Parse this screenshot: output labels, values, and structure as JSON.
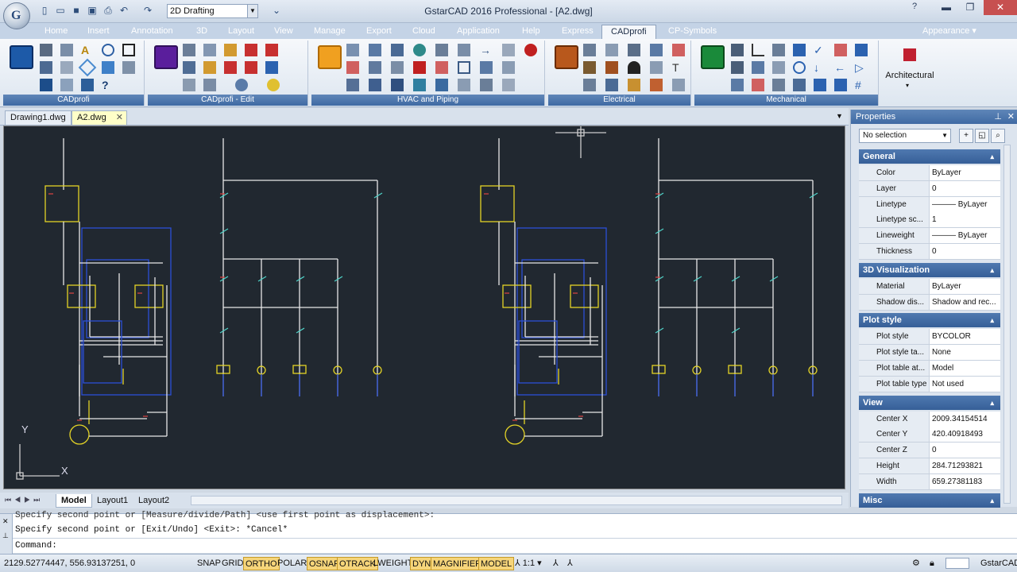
{
  "titlebar": {
    "title": "GstarCAD 2016 Professional - [A2.dwg]",
    "workspace": "2D Drafting"
  },
  "ribbon_tabs": [
    "Home",
    "Insert",
    "Annotation",
    "3D",
    "Layout",
    "View",
    "Manage",
    "Export",
    "Cloud",
    "Application",
    "Help",
    "Express",
    "CADprofi",
    "CP-Symbols"
  ],
  "active_tab": "CADprofi",
  "appearance": "Appearance",
  "panels": [
    "CADprofi",
    "CADprofi - Edit",
    "HVAC and Piping",
    "Electrical",
    "Mechanical"
  ],
  "architectural": "Architectural",
  "file_tabs": [
    "Drawing1.dwg",
    "A2.dwg"
  ],
  "layout_tabs": [
    "Model",
    "Layout1",
    "Layout2"
  ],
  "properties": {
    "title": "Properties",
    "selection": "No selection",
    "sections": [
      {
        "name": "General",
        "rows": [
          [
            "Color",
            "ByLayer"
          ],
          [
            "Layer",
            "0"
          ],
          [
            "Linetype",
            "——— ByLayer"
          ],
          [
            "Linetype sc...",
            "1"
          ],
          [
            "Lineweight",
            "——— ByLayer"
          ],
          [
            "Thickness",
            "0"
          ]
        ]
      },
      {
        "name": "3D Visualization",
        "rows": [
          [
            "Material",
            "ByLayer"
          ],
          [
            "Shadow dis...",
            "Shadow and rec..."
          ]
        ]
      },
      {
        "name": "Plot style",
        "rows": [
          [
            "Plot style",
            "BYCOLOR"
          ],
          [
            "Plot style ta...",
            "None"
          ],
          [
            "Plot table at...",
            "Model"
          ],
          [
            "Plot table type",
            "Not used"
          ]
        ]
      },
      {
        "name": "View",
        "rows": [
          [
            "Center X",
            "2009.34154514"
          ],
          [
            "Center Y",
            "420.40918493"
          ],
          [
            "Center Z",
            "0"
          ],
          [
            "Height",
            "284.71293821"
          ],
          [
            "Width",
            "659.27381183"
          ]
        ]
      },
      {
        "name": "Misc",
        "rows": []
      }
    ]
  },
  "command": {
    "line1": "Specify second point or [Measure/divide/Path] <use first point as displacement>:",
    "line2": "Specify second point or [Exit/Undo] <Exit>: *Cancel*",
    "prompt": "Command:"
  },
  "status": {
    "coords": "2129.52774447, 556.93137251, 0",
    "toggles": [
      [
        "SNAP",
        false
      ],
      [
        "GRID",
        false
      ],
      [
        "ORTHO",
        true
      ],
      [
        "POLAR",
        false
      ],
      [
        "OSNAP",
        true
      ],
      [
        "OTRACK",
        true
      ],
      [
        "LWEIGHT",
        false
      ],
      [
        "DYN",
        true
      ],
      [
        "MAGNIFIER",
        true
      ],
      [
        "MODEL",
        true
      ]
    ],
    "scale": "1:1",
    "brand": "GstarCAD"
  },
  "ucs": {
    "x": "X",
    "y": "Y"
  },
  "colors": {
    "canvas": "#212830",
    "wire": "#e8e8e8",
    "blue": "#2b4fd6",
    "yellow": "#e3d326",
    "cyan": "#4fd2c8",
    "red": "#d04040"
  }
}
